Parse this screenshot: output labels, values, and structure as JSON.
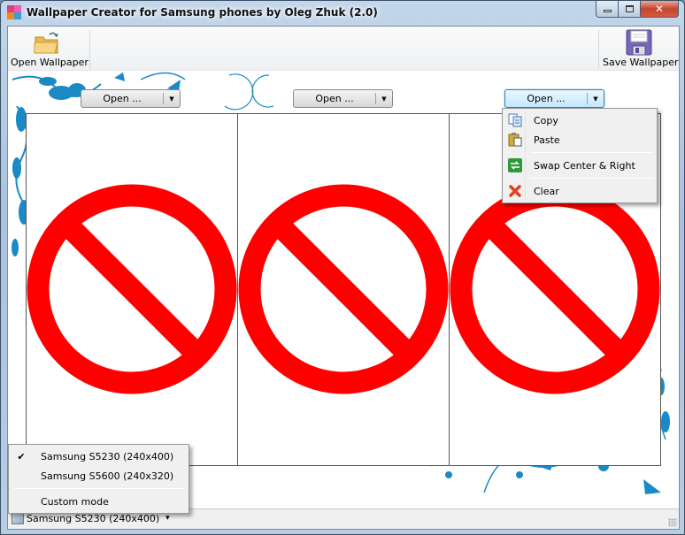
{
  "window": {
    "title": "Wallpaper Creator for Samsung phones by Oleg Zhuk (2.0)",
    "controls": {
      "minimize": "minimize",
      "maximize": "maximize",
      "close": "close"
    }
  },
  "toolbar": {
    "open_label": "Open Wallpaper",
    "open_icon": "folder-open-icon",
    "save_label": "Save Wallpaper",
    "save_icon": "floppy-disk-icon"
  },
  "panels": [
    {
      "id": "left",
      "button_label": "Open ...",
      "image": "prohibition-sign"
    },
    {
      "id": "center",
      "button_label": "Open ...",
      "image": "prohibition-sign"
    },
    {
      "id": "right",
      "button_label": "Open ...",
      "image": "prohibition-sign"
    }
  ],
  "context_menu": {
    "items": [
      {
        "label": "Copy",
        "icon": "copy-icon"
      },
      {
        "label": "Paste",
        "icon": "paste-icon"
      },
      {
        "separator": true
      },
      {
        "label": "Swap Center & Right",
        "icon": "swap-icon"
      },
      {
        "separator": true
      },
      {
        "label": "Clear",
        "icon": "clear-icon"
      }
    ]
  },
  "device_menu": {
    "items": [
      {
        "label": "Samsung S5230 (240x400)",
        "checked": true
      },
      {
        "label": "Samsung S5600 (240x320)",
        "checked": false
      },
      {
        "separator": true
      },
      {
        "label": "Custom mode",
        "checked": false
      }
    ]
  },
  "statusbar": {
    "device_label": "Samsung S5230 (240x400)",
    "dropdown_arrow": "▾",
    "check_mark": "✔"
  },
  "colors": {
    "prohibition_red": "#ff0000",
    "ornament_blue": "#1a8ac6"
  }
}
